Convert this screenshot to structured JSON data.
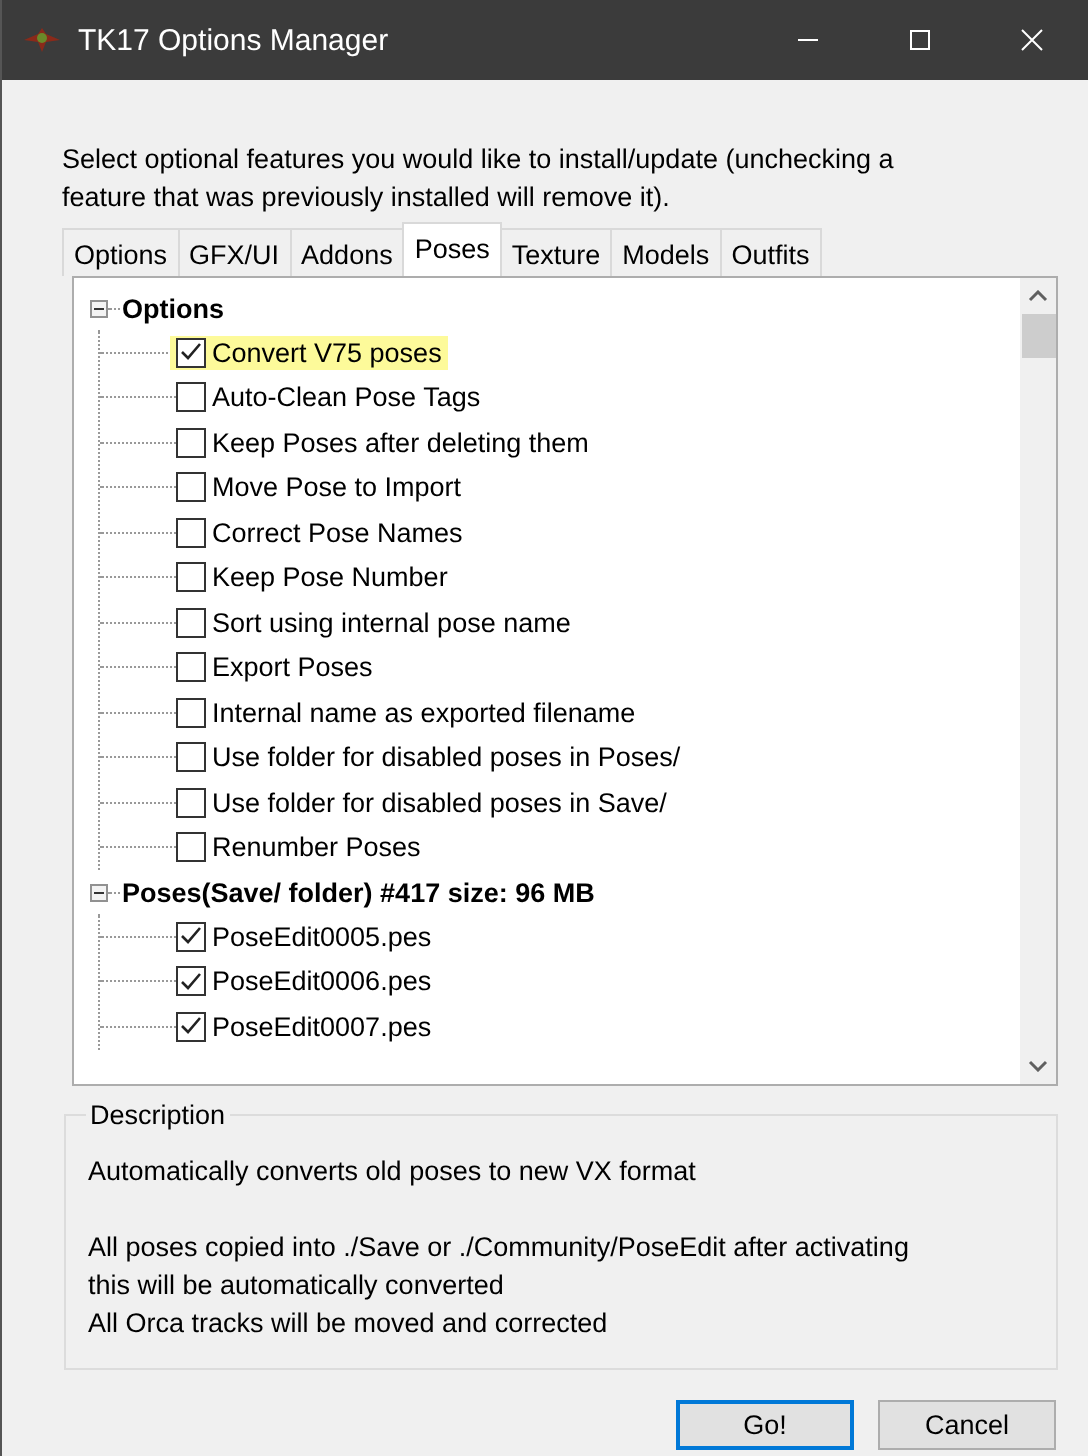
{
  "window": {
    "title": "TK17 Options Manager"
  },
  "instructions": "Select optional features you would like to install/update (unchecking a feature that was previously installed will remove it).",
  "tabs": [
    {
      "label": "Options",
      "selected": false
    },
    {
      "label": "GFX/UI",
      "selected": false
    },
    {
      "label": "Addons",
      "selected": false
    },
    {
      "label": "Poses",
      "selected": true
    },
    {
      "label": "Texture",
      "selected": false
    },
    {
      "label": "Models",
      "selected": false
    },
    {
      "label": "Outfits",
      "selected": false
    }
  ],
  "tree": [
    {
      "label": "Options",
      "expanded": true,
      "children": [
        {
          "label": "Convert V75 poses",
          "checked": true,
          "selected": true
        },
        {
          "label": "Auto-Clean Pose Tags",
          "checked": false,
          "selected": false
        },
        {
          "label": "Keep Poses after deleting them",
          "checked": false,
          "selected": false
        },
        {
          "label": "Move Pose to Import",
          "checked": false,
          "selected": false
        },
        {
          "label": "Correct Pose Names",
          "checked": false,
          "selected": false
        },
        {
          "label": "Keep Pose Number",
          "checked": false,
          "selected": false
        },
        {
          "label": "Sort using internal pose name",
          "checked": false,
          "selected": false
        },
        {
          "label": "Export Poses",
          "checked": false,
          "selected": false
        },
        {
          "label": "Internal name as exported filename",
          "checked": false,
          "selected": false
        },
        {
          "label": "Use folder for disabled poses in Poses/",
          "checked": false,
          "selected": false
        },
        {
          "label": "Use folder for disabled poses in Save/",
          "checked": false,
          "selected": false
        },
        {
          "label": "Renumber Poses",
          "checked": false,
          "selected": false
        }
      ]
    },
    {
      "label": "Poses(Save/ folder) #417 size: 96 MB",
      "expanded": true,
      "children": [
        {
          "label": "PoseEdit0005.pes",
          "checked": true,
          "selected": false
        },
        {
          "label": "PoseEdit0006.pes",
          "checked": true,
          "selected": false
        },
        {
          "label": "PoseEdit0007.pes",
          "checked": true,
          "selected": false
        }
      ]
    }
  ],
  "description": {
    "title": "Description",
    "paragraphs": [
      [
        "Automatically converts old poses to new VX format"
      ],
      [
        "All poses copied into ./Save or ./Community/PoseEdit after activating this will be automatically converted",
        "All Orca tracks will be moved and corrected"
      ]
    ]
  },
  "buttons": [
    {
      "label": "Go!",
      "selected": true
    },
    {
      "label": "Cancel",
      "selected": false
    }
  ]
}
